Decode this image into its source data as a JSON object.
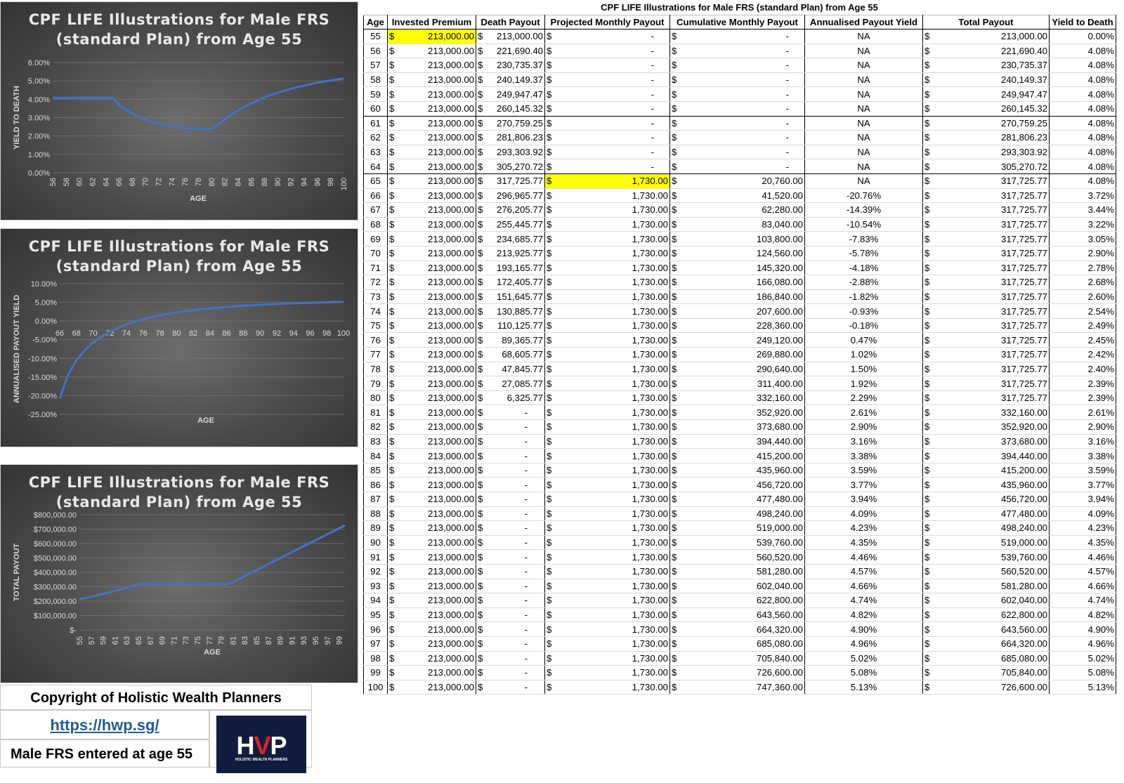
{
  "table": {
    "title": "CPF LIFE Illustrations for Male FRS (standard Plan) from Age 55",
    "headers": [
      "Age",
      "Invested Premium",
      "Death Payout",
      "Projected Monthly Payout",
      "Cumulative Monthly Payout",
      "Annualised Payout Yield",
      "Total Payout",
      "Yield to Death"
    ],
    "currency": "$",
    "highlight_color": "#ffff00",
    "rows": [
      [
        "55",
        "213,000.00",
        "213,000.00",
        "-",
        "-",
        "NA",
        "213,000.00",
        "0.00%"
      ],
      [
        "56",
        "213,000.00",
        "221,690.40",
        "-",
        "-",
        "NA",
        "221,690.40",
        "4.08%"
      ],
      [
        "57",
        "213,000.00",
        "230,735.37",
        "-",
        "-",
        "NA",
        "230,735.37",
        "4.08%"
      ],
      [
        "58",
        "213,000.00",
        "240,149.37",
        "-",
        "-",
        "NA",
        "240,149.37",
        "4.08%"
      ],
      [
        "59",
        "213,000.00",
        "249,947.47",
        "-",
        "-",
        "NA",
        "249,947.47",
        "4.08%"
      ],
      [
        "60",
        "213,000.00",
        "260,145.32",
        "-",
        "-",
        "NA",
        "260,145.32",
        "4.08%"
      ],
      [
        "61",
        "213,000.00",
        "270,759.25",
        "-",
        "-",
        "NA",
        "270,759.25",
        "4.08%"
      ],
      [
        "62",
        "213,000.00",
        "281,806.23",
        "-",
        "-",
        "NA",
        "281,806.23",
        "4.08%"
      ],
      [
        "63",
        "213,000.00",
        "293,303.92",
        "-",
        "-",
        "NA",
        "293,303.92",
        "4.08%"
      ],
      [
        "64",
        "213,000.00",
        "305,270.72",
        "-",
        "-",
        "NA",
        "305,270.72",
        "4.08%"
      ],
      [
        "65",
        "213,000.00",
        "317,725.77",
        "1,730.00",
        "20,760.00",
        "NA",
        "317,725.77",
        "4.08%"
      ],
      [
        "66",
        "213,000.00",
        "296,965.77",
        "1,730.00",
        "41,520.00",
        "-20.76%",
        "317,725.77",
        "3.72%"
      ],
      [
        "67",
        "213,000.00",
        "276,205.77",
        "1,730.00",
        "62,280.00",
        "-14.39%",
        "317,725.77",
        "3.44%"
      ],
      [
        "68",
        "213,000.00",
        "255,445.77",
        "1,730.00",
        "83,040.00",
        "-10.54%",
        "317,725.77",
        "3.22%"
      ],
      [
        "69",
        "213,000.00",
        "234,685.77",
        "1,730.00",
        "103,800.00",
        "-7.83%",
        "317,725.77",
        "3.05%"
      ],
      [
        "70",
        "213,000.00",
        "213,925.77",
        "1,730.00",
        "124,560.00",
        "-5.78%",
        "317,725.77",
        "2.90%"
      ],
      [
        "71",
        "213,000.00",
        "193,165.77",
        "1,730.00",
        "145,320.00",
        "-4.18%",
        "317,725.77",
        "2.78%"
      ],
      [
        "72",
        "213,000.00",
        "172,405.77",
        "1,730.00",
        "166,080.00",
        "-2.88%",
        "317,725.77",
        "2.68%"
      ],
      [
        "73",
        "213,000.00",
        "151,645.77",
        "1,730.00",
        "186,840.00",
        "-1.82%",
        "317,725.77",
        "2.60%"
      ],
      [
        "74",
        "213,000.00",
        "130,885.77",
        "1,730.00",
        "207,600.00",
        "-0.93%",
        "317,725.77",
        "2.54%"
      ],
      [
        "75",
        "213,000.00",
        "110,125.77",
        "1,730.00",
        "228,360.00",
        "-0.18%",
        "317,725.77",
        "2.49%"
      ],
      [
        "76",
        "213,000.00",
        "89,365.77",
        "1,730.00",
        "249,120.00",
        "0.47%",
        "317,725.77",
        "2.45%"
      ],
      [
        "77",
        "213,000.00",
        "68,605.77",
        "1,730.00",
        "269,880.00",
        "1.02%",
        "317,725.77",
        "2.42%"
      ],
      [
        "78",
        "213,000.00",
        "47,845.77",
        "1,730.00",
        "290,640.00",
        "1.50%",
        "317,725.77",
        "2.40%"
      ],
      [
        "79",
        "213,000.00",
        "27,085.77",
        "1,730.00",
        "311,400.00",
        "1.92%",
        "317,725.77",
        "2.39%"
      ],
      [
        "80",
        "213,000.00",
        "6,325.77",
        "1,730.00",
        "332,160.00",
        "2.29%",
        "317,725.77",
        "2.39%"
      ],
      [
        "81",
        "213,000.00",
        "-",
        "1,730.00",
        "352,920.00",
        "2.61%",
        "332,160.00",
        "2.61%"
      ],
      [
        "82",
        "213,000.00",
        "-",
        "1,730.00",
        "373,680.00",
        "2.90%",
        "352,920.00",
        "2.90%"
      ],
      [
        "83",
        "213,000.00",
        "-",
        "1,730.00",
        "394,440.00",
        "3.16%",
        "373,680.00",
        "3.16%"
      ],
      [
        "84",
        "213,000.00",
        "-",
        "1,730.00",
        "415,200.00",
        "3.38%",
        "394,440.00",
        "3.38%"
      ],
      [
        "85",
        "213,000.00",
        "-",
        "1,730.00",
        "435,960.00",
        "3.59%",
        "415,200.00",
        "3.59%"
      ],
      [
        "86",
        "213,000.00",
        "-",
        "1,730.00",
        "456,720.00",
        "3.77%",
        "435,960.00",
        "3.77%"
      ],
      [
        "87",
        "213,000.00",
        "-",
        "1,730.00",
        "477,480.00",
        "3.94%",
        "456,720.00",
        "3.94%"
      ],
      [
        "88",
        "213,000.00",
        "-",
        "1,730.00",
        "498,240.00",
        "4.09%",
        "477,480.00",
        "4.09%"
      ],
      [
        "89",
        "213,000.00",
        "-",
        "1,730.00",
        "519,000.00",
        "4.23%",
        "498,240.00",
        "4.23%"
      ],
      [
        "90",
        "213,000.00",
        "-",
        "1,730.00",
        "539,760.00",
        "4.35%",
        "519,000.00",
        "4.35%"
      ],
      [
        "91",
        "213,000.00",
        "-",
        "1,730.00",
        "560,520.00",
        "4.46%",
        "539,760.00",
        "4.46%"
      ],
      [
        "92",
        "213,000.00",
        "-",
        "1,730.00",
        "581,280.00",
        "4.57%",
        "560,520.00",
        "4.57%"
      ],
      [
        "93",
        "213,000.00",
        "-",
        "1,730.00",
        "602,040.00",
        "4.66%",
        "581,280.00",
        "4.66%"
      ],
      [
        "94",
        "213,000.00",
        "-",
        "1,730.00",
        "622,800.00",
        "4.74%",
        "602,040.00",
        "4.74%"
      ],
      [
        "95",
        "213,000.00",
        "-",
        "1,730.00",
        "643,560.00",
        "4.82%",
        "622,800.00",
        "4.82%"
      ],
      [
        "96",
        "213,000.00",
        "-",
        "1,730.00",
        "664,320.00",
        "4.90%",
        "643,560.00",
        "4.90%"
      ],
      [
        "97",
        "213,000.00",
        "-",
        "1,730.00",
        "685,080.00",
        "4.96%",
        "664,320.00",
        "4.96%"
      ],
      [
        "98",
        "213,000.00",
        "-",
        "1,730.00",
        "705,840.00",
        "5.02%",
        "685,080.00",
        "5.02%"
      ],
      [
        "99",
        "213,000.00",
        "-",
        "1,730.00",
        "726,600.00",
        "5.08%",
        "705,840.00",
        "5.08%"
      ],
      [
        "100",
        "213,000.00",
        "-",
        "1,730.00",
        "747,360.00",
        "5.13%",
        "726,600.00",
        "5.13%"
      ]
    ]
  },
  "footer": {
    "copyright": "Copyright of Holistic Wealth Planners",
    "link": "https://hwp.sg/",
    "note": "Male FRS entered at age 55",
    "logo_text_left": "H",
    "logo_text_mid": "V",
    "logo_text_right": "P",
    "logo_subtext": "HOLISTIC WEALTH PLANNERS"
  },
  "chart_data": [
    {
      "type": "line",
      "title": [
        "CPF LIFE Illustrations for Male FRS",
        "(standard Plan) from Age 55"
      ],
      "xlabel": "AGE",
      "ylabel": "YIELD TO DEATH",
      "line_color": "#4472c4",
      "x": [
        56,
        57,
        58,
        59,
        60,
        61,
        62,
        63,
        64,
        65,
        66,
        67,
        68,
        69,
        70,
        71,
        72,
        73,
        74,
        75,
        76,
        77,
        78,
        79,
        80,
        81,
        82,
        83,
        84,
        85,
        86,
        87,
        88,
        89,
        90,
        91,
        92,
        93,
        94,
        95,
        96,
        97,
        98,
        99,
        100
      ],
      "y": [
        4.08,
        4.08,
        4.08,
        4.08,
        4.08,
        4.08,
        4.08,
        4.08,
        4.08,
        4.08,
        3.72,
        3.44,
        3.22,
        3.05,
        2.9,
        2.78,
        2.68,
        2.6,
        2.54,
        2.49,
        2.45,
        2.42,
        2.4,
        2.39,
        2.39,
        2.61,
        2.9,
        3.16,
        3.38,
        3.59,
        3.77,
        3.94,
        4.09,
        4.23,
        4.35,
        4.46,
        4.57,
        4.66,
        4.74,
        4.82,
        4.9,
        4.96,
        5.02,
        5.08,
        5.13
      ],
      "ylim": [
        0,
        6
      ],
      "yticks": [
        "0.00%",
        "1.00%",
        "2.00%",
        "3.00%",
        "4.00%",
        "5.00%",
        "6.00%"
      ],
      "xticks": [
        "56",
        "58",
        "60",
        "62",
        "64",
        "66",
        "68",
        "70",
        "72",
        "74",
        "76",
        "78",
        "80",
        "82",
        "84",
        "86",
        "88",
        "90",
        "92",
        "94",
        "96",
        "98",
        "100"
      ]
    },
    {
      "type": "line",
      "title": [
        "CPF LIFE Illustrations for Male FRS",
        "(standard Plan) from Age 55"
      ],
      "xlabel": "AGE",
      "ylabel": "ANNUALISED PAYOUT YIELD",
      "line_color": "#4472c4",
      "x": [
        66,
        67,
        68,
        69,
        70,
        71,
        72,
        73,
        74,
        75,
        76,
        77,
        78,
        79,
        80,
        81,
        82,
        83,
        84,
        85,
        86,
        87,
        88,
        89,
        90,
        91,
        92,
        93,
        94,
        95,
        96,
        97,
        98,
        99,
        100
      ],
      "y": [
        -20.76,
        -14.39,
        -10.54,
        -7.83,
        -5.78,
        -4.18,
        -2.88,
        -1.82,
        -0.93,
        -0.18,
        0.47,
        1.02,
        1.5,
        1.92,
        2.29,
        2.61,
        2.9,
        3.16,
        3.38,
        3.59,
        3.77,
        3.94,
        4.09,
        4.23,
        4.35,
        4.46,
        4.57,
        4.66,
        4.74,
        4.82,
        4.9,
        4.96,
        5.02,
        5.08,
        5.13
      ],
      "ylim": [
        -25,
        10
      ],
      "yticks": [
        "-25.00%",
        "-20.00%",
        "-15.00%",
        "-10.00%",
        "-5.00%",
        "0.00%",
        "5.00%",
        "10.00%"
      ],
      "xticks": [
        "66",
        "68",
        "70",
        "72",
        "74",
        "76",
        "78",
        "80",
        "82",
        "84",
        "86",
        "88",
        "90",
        "92",
        "94",
        "96",
        "98",
        "100"
      ]
    },
    {
      "type": "line",
      "title": [
        "CPF LIFE Illustrations for Male FRS",
        "(standard Plan) from Age 55"
      ],
      "xlabel": "AGE",
      "ylabel": "TOTAL PAYOUT",
      "line_color": "#4472c4",
      "x": [
        55,
        56,
        57,
        58,
        59,
        60,
        61,
        62,
        63,
        64,
        65,
        66,
        67,
        68,
        69,
        70,
        71,
        72,
        73,
        74,
        75,
        76,
        77,
        78,
        79,
        80,
        81,
        82,
        83,
        84,
        85,
        86,
        87,
        88,
        89,
        90,
        91,
        92,
        93,
        94,
        95,
        96,
        97,
        98,
        99,
        100
      ],
      "y": [
        213000.0,
        221690.4,
        230735.37,
        240149.37,
        249947.47,
        260145.32,
        270759.25,
        281806.23,
        293303.92,
        305270.72,
        317725.77,
        317725.77,
        317725.77,
        317725.77,
        317725.77,
        317725.77,
        317725.77,
        317725.77,
        317725.77,
        317725.77,
        317725.77,
        317725.77,
        317725.77,
        317725.77,
        317725.77,
        317725.77,
        332160.0,
        352920.0,
        373680.0,
        394440.0,
        415200.0,
        435960.0,
        456720.0,
        477480.0,
        498240.0,
        519000.0,
        539760.0,
        560520.0,
        581280.0,
        602040.0,
        622800.0,
        643560.0,
        664320.0,
        685080.0,
        705840.0,
        726600.0
      ],
      "ylim": [
        0,
        800000
      ],
      "yticks": [
        "$-",
        "$100,000.00",
        "$200,000.00",
        "$300,000.00",
        "$400,000.00",
        "$500,000.00",
        "$600,000.00",
        "$700,000.00",
        "$800,000.00"
      ],
      "xticks": [
        "55",
        "57",
        "59",
        "61",
        "63",
        "65",
        "67",
        "69",
        "71",
        "73",
        "75",
        "77",
        "79",
        "81",
        "83",
        "85",
        "87",
        "89",
        "91",
        "93",
        "95",
        "97",
        "99"
      ]
    }
  ]
}
